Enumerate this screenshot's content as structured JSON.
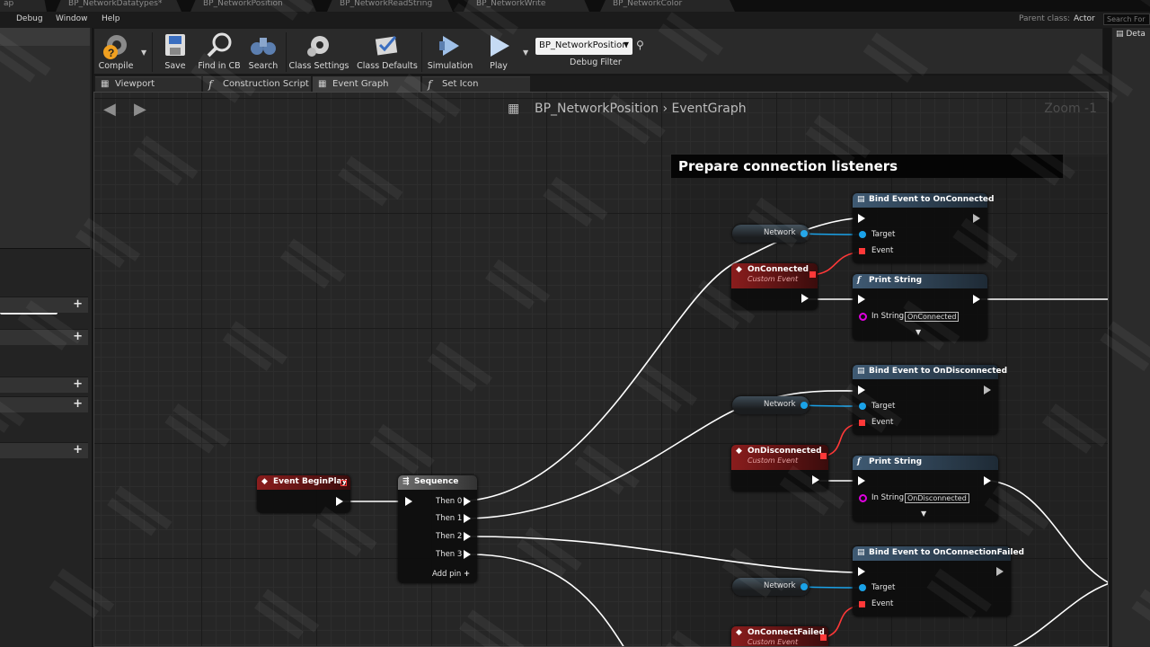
{
  "doc_tabs": [
    "ap",
    "BP_NetworkDatatypes*",
    "BP_NetworkPosition",
    "BP_NetworkReadString",
    "BP_NetworkWrite",
    "BP_NetworkColor"
  ],
  "menu": [
    "Debug",
    "Window",
    "Help"
  ],
  "parent_class_label": "Parent class:",
  "parent_class_value": "Actor",
  "top_search_placeholder": "Search For",
  "toolbar": {
    "compile": "Compile",
    "save": "Save",
    "find_in_cb": "Find in CB",
    "search": "Search",
    "class_settings": "Class Settings",
    "class_defaults": "Class Defaults",
    "simulation": "Simulation",
    "play": "Play",
    "debug_filter_value": "BP_NetworkPosition",
    "debug_filter_label": "Debug Filter"
  },
  "right_panel_tab": "Deta",
  "editor_tabs": [
    {
      "label": "Viewport",
      "icon": "viewport-icon"
    },
    {
      "label": "Construction Script",
      "icon": "function-icon"
    },
    {
      "label": "Event Graph",
      "icon": "graph-icon"
    },
    {
      "label": "Set Icon",
      "icon": "function-icon"
    }
  ],
  "graph": {
    "breadcrumb_root": "BP_NetworkPosition",
    "breadcrumb_sep": "›",
    "breadcrumb_leaf": "EventGraph",
    "zoom": "Zoom -1",
    "comment_title": "Prepare connection listeners"
  },
  "nodes": {
    "begin_play": "Event BeginPlay",
    "sequence": {
      "title": "Sequence",
      "pins": [
        "Then 0",
        "Then 1",
        "Then 2",
        "Then 3"
      ],
      "add_pin": "Add pin"
    },
    "bind_connected": "Bind Event to OnConnected",
    "bind_disconnected": "Bind Event to OnDisconnected",
    "bind_failed": "Bind Event to OnConnectionFailed",
    "target_label": "Target",
    "event_label": "Event",
    "network_var": "Network",
    "on_connected": "OnConnected",
    "on_disconnected": "OnDisconnected",
    "on_connect_failed": "OnConnectFailed",
    "custom_event_sub": "Custom Event",
    "print_string": "Print String",
    "in_string_label": "In String",
    "print1_value": "OnConnected",
    "print2_value": "OnDisconnected"
  },
  "colors": {
    "exec_wire": "#ffffff",
    "object_pin": "#1aa2e8",
    "delegate_pin": "#ff3838",
    "string_pin": "#e000e0",
    "event_header": "#8a1d1d",
    "function_header": "#3f5a73"
  }
}
